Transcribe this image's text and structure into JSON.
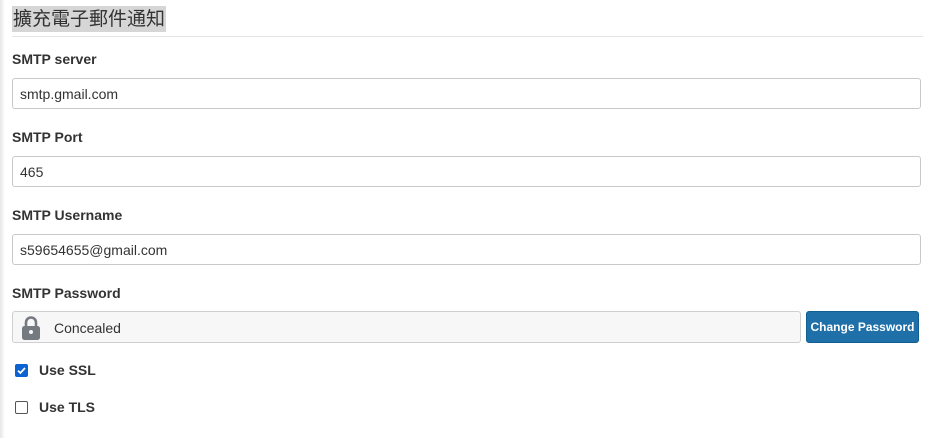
{
  "section": {
    "title": "擴充電子郵件通知"
  },
  "smtp_server": {
    "label": "SMTP server",
    "value": "smtp.gmail.com"
  },
  "smtp_port": {
    "label": "SMTP Port",
    "value": "465"
  },
  "smtp_username": {
    "label": "SMTP Username",
    "value": "s59654655@gmail.com"
  },
  "smtp_password": {
    "label": "SMTP Password",
    "status": "Concealed",
    "change_button": "Change Password",
    "icon": "lock-icon"
  },
  "use_ssl": {
    "label": "Use SSL",
    "checked": true
  },
  "use_tls": {
    "label": "Use TLS",
    "checked": false
  },
  "colors": {
    "button": "#1f6fa8",
    "checkbox_checked": "#0b63d1"
  }
}
